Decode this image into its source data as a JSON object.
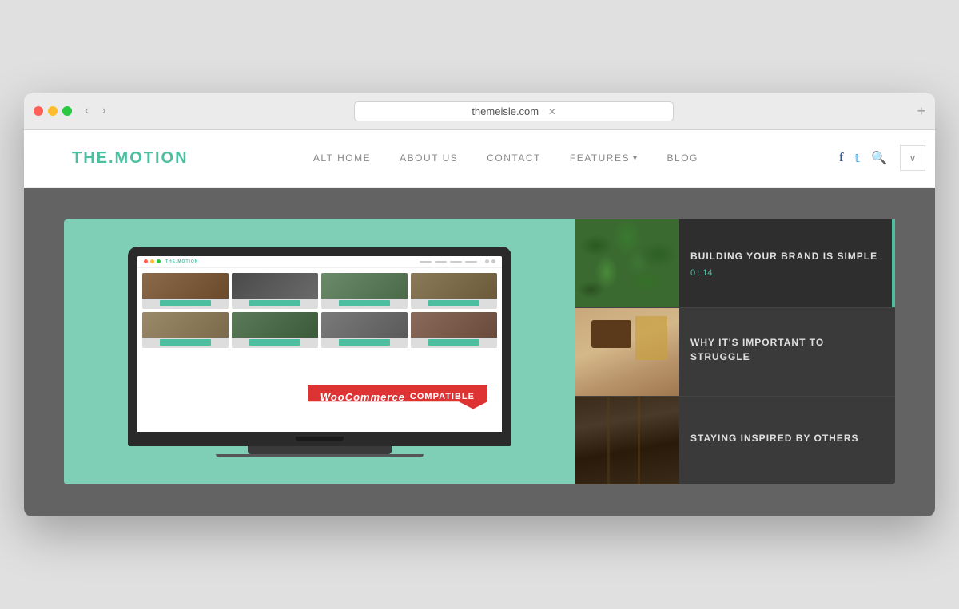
{
  "browser": {
    "url": "themeisle.com",
    "tab_close": "✕",
    "add_tab": "+",
    "nav_back": "‹",
    "nav_forward": "›",
    "dropdown_icon": "∨"
  },
  "site": {
    "logo": "THE.MOTION",
    "nav": {
      "items": [
        {
          "label": "ALT HOME",
          "id": "alt-home"
        },
        {
          "label": "ABOUT US",
          "id": "about-us"
        },
        {
          "label": "CONTACT",
          "id": "contact"
        },
        {
          "label": "FEATURES",
          "id": "features",
          "has_dropdown": true
        },
        {
          "label": "BLOG",
          "id": "blog"
        }
      ],
      "social": {
        "facebook_icon": "f",
        "twitter_icon": "t",
        "search_icon": "⌕"
      }
    }
  },
  "mini_site": {
    "logo": "THE.MOTION",
    "woo_badge": {
      "brand": "WooCommerce",
      "label": "COMPATIBLE"
    }
  },
  "sidebar_cards": [
    {
      "id": "card-1",
      "title": "BUILDING YOUR BRAND IS SIMPLE",
      "time": "0 : 14",
      "active": true
    },
    {
      "id": "card-2",
      "title": "WHY IT'S IMPORTANT TO STRUGGLE",
      "time": "",
      "active": false
    },
    {
      "id": "card-3",
      "title": "STAYING INSPIRED BY OTHERS",
      "time": "",
      "active": false
    }
  ],
  "colors": {
    "accent": "#4BBFA0",
    "dark_bg": "#636363",
    "sidebar_bg": "#3a3a3a",
    "logo_color": "#4BBFA0"
  }
}
